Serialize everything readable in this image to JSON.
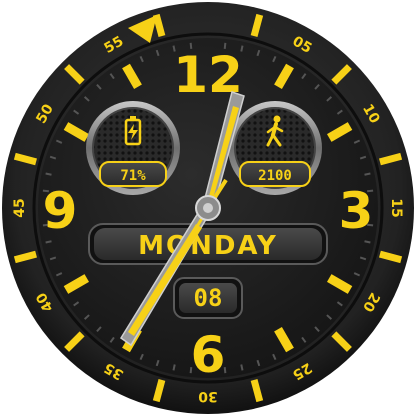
{
  "bezel": {
    "minute_labels": [
      "05",
      "10",
      "15",
      "20",
      "25",
      "30",
      "35",
      "40",
      "45",
      "50",
      "55"
    ]
  },
  "dial": {
    "hour_numerals": {
      "twelve": "12",
      "three": "3",
      "six": "6",
      "nine": "9"
    }
  },
  "battery": {
    "value": "71%",
    "icon": "battery-icon"
  },
  "steps": {
    "value": "2100",
    "icon": "walking-person-icon"
  },
  "day_window": {
    "day": "MONDAY"
  },
  "date_window": {
    "date": "08"
  },
  "hands": {
    "hour": "1:00",
    "minute": "35",
    "second": "35"
  },
  "colors": {
    "accent": "#f7d117",
    "bezel": "#222222",
    "dial": "#1c1c1c",
    "subdial_ring": "#8a8a8a",
    "window": "#3a3a3a",
    "background": "#ffffff"
  }
}
